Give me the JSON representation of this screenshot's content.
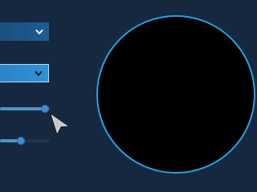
{
  "dropdowns": [
    {
      "name": "first",
      "state": "default",
      "icon": "chevron-down-icon"
    },
    {
      "name": "second",
      "state": "focused",
      "icon": "chevron-down-icon"
    }
  ],
  "sliders": [
    {
      "name": "first",
      "value_fraction": 0.88
    },
    {
      "name": "second",
      "value_fraction": 0.42
    }
  ],
  "preview": {
    "shape": "circle",
    "fill_color": "#000000",
    "border_color": "#27a3e3"
  },
  "colors": {
    "background": "#16283f",
    "accent": "#2f93d7",
    "slider_fill": "#4f93c8"
  },
  "cursor": {
    "icon": "arrow-cursor-icon"
  }
}
